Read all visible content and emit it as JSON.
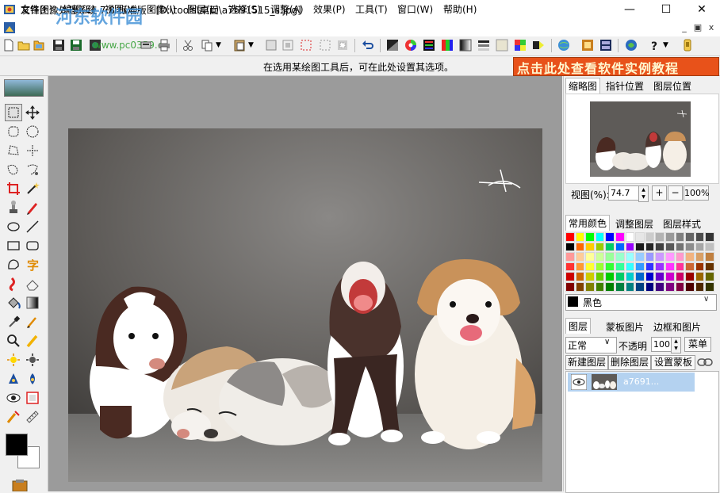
{
  "window": {
    "title": "友锋图像处理系统 7.8 标准版 - [D:\\tools\\桌面\\a7691515_s.jpg]",
    "minimize_glyph": "—",
    "maximize_glyph": "☐",
    "close_glyph": "✕"
  },
  "watermark": {
    "text": "河东软件园",
    "url": "www.pc0359.cn"
  },
  "menu": {
    "items": [
      "文件(F)",
      "编辑(E)",
      "视图(V)",
      "图像(I)",
      "图层(L)",
      "选择(S)",
      "调整(A)",
      "效果(P)",
      "工具(T)",
      "窗口(W)",
      "帮助(H)"
    ],
    "mdi_controls": [
      "_",
      "▣",
      "x"
    ]
  },
  "options_bar": {
    "hint": "在选用某绘图工具后，可在此处设置其选项。",
    "banner": "点击此处查看软件实例教程"
  },
  "tools": [
    {
      "name": "rect-select-tool",
      "active": true
    },
    {
      "name": "move-tool"
    },
    {
      "name": "rounded-rect-select-tool"
    },
    {
      "name": "ellipse-select-tool"
    },
    {
      "name": "lasso-tool"
    },
    {
      "name": "polygon-lasso-tool"
    },
    {
      "name": "freehand-select-tool"
    },
    {
      "name": "magnetic-lasso-tool"
    },
    {
      "name": "crop-tool"
    },
    {
      "name": "magic-wand-tool"
    },
    {
      "name": "clone-stamp-tool"
    },
    {
      "name": "pencil-tool"
    },
    {
      "name": "ellipse-shape-tool"
    },
    {
      "name": "line-tool"
    },
    {
      "name": "rectangle-shape-tool"
    },
    {
      "name": "rounded-rectangle-shape-tool"
    },
    {
      "name": "polygon-shape-tool"
    },
    {
      "name": "text-tool"
    },
    {
      "name": "smudge-tool"
    },
    {
      "name": "eraser-tool"
    },
    {
      "name": "paint-bucket-tool"
    },
    {
      "name": "gradient-tool"
    },
    {
      "name": "eyedropper-tool"
    },
    {
      "name": "brush-tool"
    },
    {
      "name": "zoom-tool"
    },
    {
      "name": "highlighter-tool"
    },
    {
      "name": "dodge-tool"
    },
    {
      "name": "burn-tool"
    },
    {
      "name": "sharpen-tool"
    },
    {
      "name": "blur-tool"
    },
    {
      "name": "red-eye-tool"
    },
    {
      "name": "frame-tool"
    },
    {
      "name": "healing-tool"
    },
    {
      "name": "ruler-tool"
    }
  ],
  "navigator": {
    "tabs": [
      "缩略图",
      "指针位置",
      "图层位置"
    ],
    "zoom_label": "视图(%):",
    "zoom_value": "74.7",
    "zoom_in": "+",
    "zoom_out": "−",
    "zoom_100": "100%"
  },
  "color_panel": {
    "tabs": [
      "常用颜色",
      "调整图层",
      "图层样式"
    ],
    "selected_color_name": "黑色",
    "swatches": [
      "#ff0000",
      "#ffff00",
      "#00ff00",
      "#00ffff",
      "#0000ff",
      "#ff00ff",
      "#ffffff",
      "#e6e6e6",
      "#cccccc",
      "#b3b3b3",
      "#999999",
      "#808080",
      "#666666",
      "#4d4d4d",
      "#333333",
      "#000000",
      "#ff6600",
      "#ffcc00",
      "#99cc00",
      "#00cc66",
      "#0066ff",
      "#9900ff",
      "#1a1a1a",
      "#262626",
      "#404040",
      "#595959",
      "#737373",
      "#8c8c8c",
      "#a6a6a6",
      "#bfbfbf",
      "#ff9999",
      "#ffcc99",
      "#ffff99",
      "#ccff99",
      "#99ff99",
      "#99ffcc",
      "#99ffff",
      "#99ccff",
      "#9999ff",
      "#cc99ff",
      "#ff99ff",
      "#ff99cc",
      "#f2b380",
      "#d9a066",
      "#c08040",
      "#ff3333",
      "#ff9933",
      "#ffff33",
      "#99ff33",
      "#33ff33",
      "#33ff99",
      "#33ffff",
      "#3399ff",
      "#3333ff",
      "#9933ff",
      "#ff33ff",
      "#ff3399",
      "#cc6633",
      "#993300",
      "#663300",
      "#cc0000",
      "#cc6600",
      "#cccc00",
      "#66cc00",
      "#00cc00",
      "#00cc66",
      "#00cccc",
      "#0066cc",
      "#0000cc",
      "#6600cc",
      "#cc00cc",
      "#cc0066",
      "#990000",
      "#996600",
      "#666600",
      "#800000",
      "#804000",
      "#808000",
      "#408000",
      "#008000",
      "#008040",
      "#008080",
      "#004080",
      "#000080",
      "#400080",
      "#800080",
      "#800040",
      "#4d0000",
      "#4d2600",
      "#333300"
    ]
  },
  "layers_panel": {
    "tabs": [
      "图层",
      "蒙板图片",
      "边框和图片"
    ],
    "blend_mode": "正常",
    "opacity_label": "不透明",
    "opacity_value": "100",
    "menu_button": "菜单",
    "actions": [
      "新建图层",
      "删除图层",
      "设置蒙板"
    ],
    "layer_name": "a7691..."
  }
}
